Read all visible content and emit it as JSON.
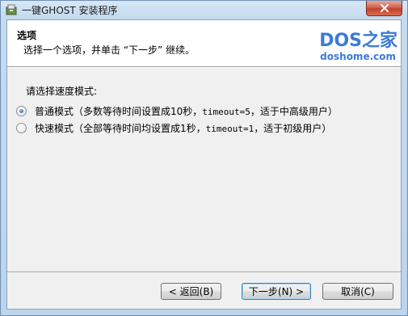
{
  "window": {
    "title": "一键GHOST 安装程序",
    "close_symbol": "✕",
    "app_icon": "installer-icon"
  },
  "header": {
    "title": "选项",
    "subtitle": "选择一个选项，并单击 “下一步” 继续。",
    "logo_main": "DOS之家",
    "logo_sub": "doshome.com"
  },
  "body": {
    "prompt": "请选择速度模式:",
    "options": [
      {
        "label_prefix": "普通模式（多数等待时间设置成10秒，",
        "label_code": "timeout=5",
        "label_suffix": "，适于中高级用户）",
        "checked": true
      },
      {
        "label_prefix": "快速模式（全部等待时间均设置成1秒，",
        "label_code": "timeout=1",
        "label_suffix": "，适于初级用户）",
        "checked": false
      }
    ]
  },
  "buttons": {
    "back": "< 返回(B)",
    "next": "下一步(N) >",
    "cancel": "取消(C)"
  },
  "colors": {
    "logo": "#3b7bd6",
    "close_button": "#c1412a",
    "frame": "#bcd4ec"
  }
}
